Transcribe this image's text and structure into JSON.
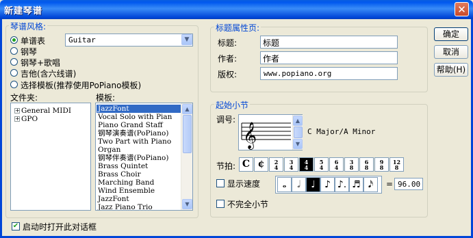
{
  "window": {
    "title": "新建琴谱",
    "close_glyph": "✕"
  },
  "style_group": {
    "legend": "琴谱风格:",
    "options": [
      "单谱表",
      "钢琴",
      "钢琴+歌唱",
      "吉他(含六线谱)",
      "选择模板(推荐使用PoPiano模板)"
    ],
    "selected_index": 0,
    "instrument": "Guitar"
  },
  "folders": {
    "label": "文件夹:",
    "items": [
      "General MIDI",
      "GPO"
    ]
  },
  "templates": {
    "label": "模板:",
    "items": [
      "JazzFont",
      "Vocal Solo with Pian",
      "Piano Grand Staff",
      "钢琴演奏谱(PoPiano)",
      "Two Part with Piano",
      "Organ",
      "钢琴伴奏谱(PoPiano)",
      "Brass Quintet",
      "Brass Choir",
      "Marching Band",
      "Wind Ensemble",
      "JazzFont",
      "Jazz Piano Trio"
    ],
    "selected_index": 0
  },
  "title_group": {
    "legend": "标题属性页:",
    "fields": [
      {
        "label": "标题:",
        "value": "标题"
      },
      {
        "label": "作者:",
        "value": "作者"
      },
      {
        "label": "版权:",
        "value": "www.popiano.org"
      }
    ]
  },
  "buttons": {
    "ok": "确定",
    "cancel": "取消",
    "help": "帮助(H)"
  },
  "measure_group": {
    "legend": "起始小节",
    "key_label": "调号:",
    "key_value": "C Major/A Minor",
    "time_label": "节拍:",
    "time_signatures": [
      {
        "num": "C",
        "den": ""
      },
      {
        "num": "¢",
        "den": ""
      },
      {
        "num": "2",
        "den": "4"
      },
      {
        "num": "3",
        "den": "4"
      },
      {
        "num": "4",
        "den": "4"
      },
      {
        "num": "5",
        "den": "4"
      },
      {
        "num": "6",
        "den": "4"
      },
      {
        "num": "3",
        "den": "8"
      },
      {
        "num": "6",
        "den": "8"
      },
      {
        "num": "9",
        "den": "8"
      },
      {
        "num": "12",
        "den": "8"
      }
    ],
    "time_selected_index": 4,
    "tempo_label": "显示速度",
    "tempo_checked": false,
    "notes": [
      "𝅝",
      "𝅗𝅥",
      "♩",
      "♪",
      "♪.",
      "♬",
      "𝅘𝅥𝅯"
    ],
    "note_selected_index": 2,
    "equals": "=",
    "tempo_value": "96.00",
    "pickup_label": "不完全小节",
    "pickup_checked": false
  },
  "footer": {
    "startup_label": "启动时打开此对话框",
    "startup_checked": true,
    "check_glyph": "✔"
  }
}
